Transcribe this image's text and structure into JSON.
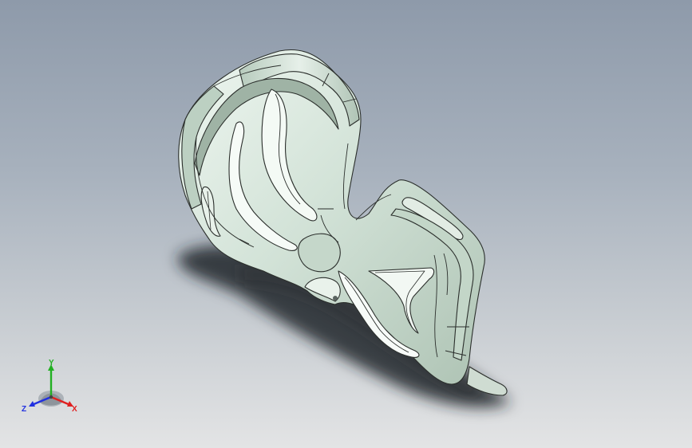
{
  "viewport": {
    "background_top": "#8e9aaa",
    "background_bottom": "#e3e4e5"
  },
  "model": {
    "face_color": "#d2e2d6",
    "face_highlight": "#ecf5ee",
    "face_shadow": "#a8bcae",
    "edge_color": "#2b2f2c",
    "shadow_color": "#1c1f24"
  },
  "triad": {
    "x_label": "X",
    "y_label": "Y",
    "z_label": "Z",
    "x_color": "#e02020",
    "y_color": "#22b022",
    "z_color": "#2030e0",
    "icon": "view-orientation-triad-icon"
  }
}
